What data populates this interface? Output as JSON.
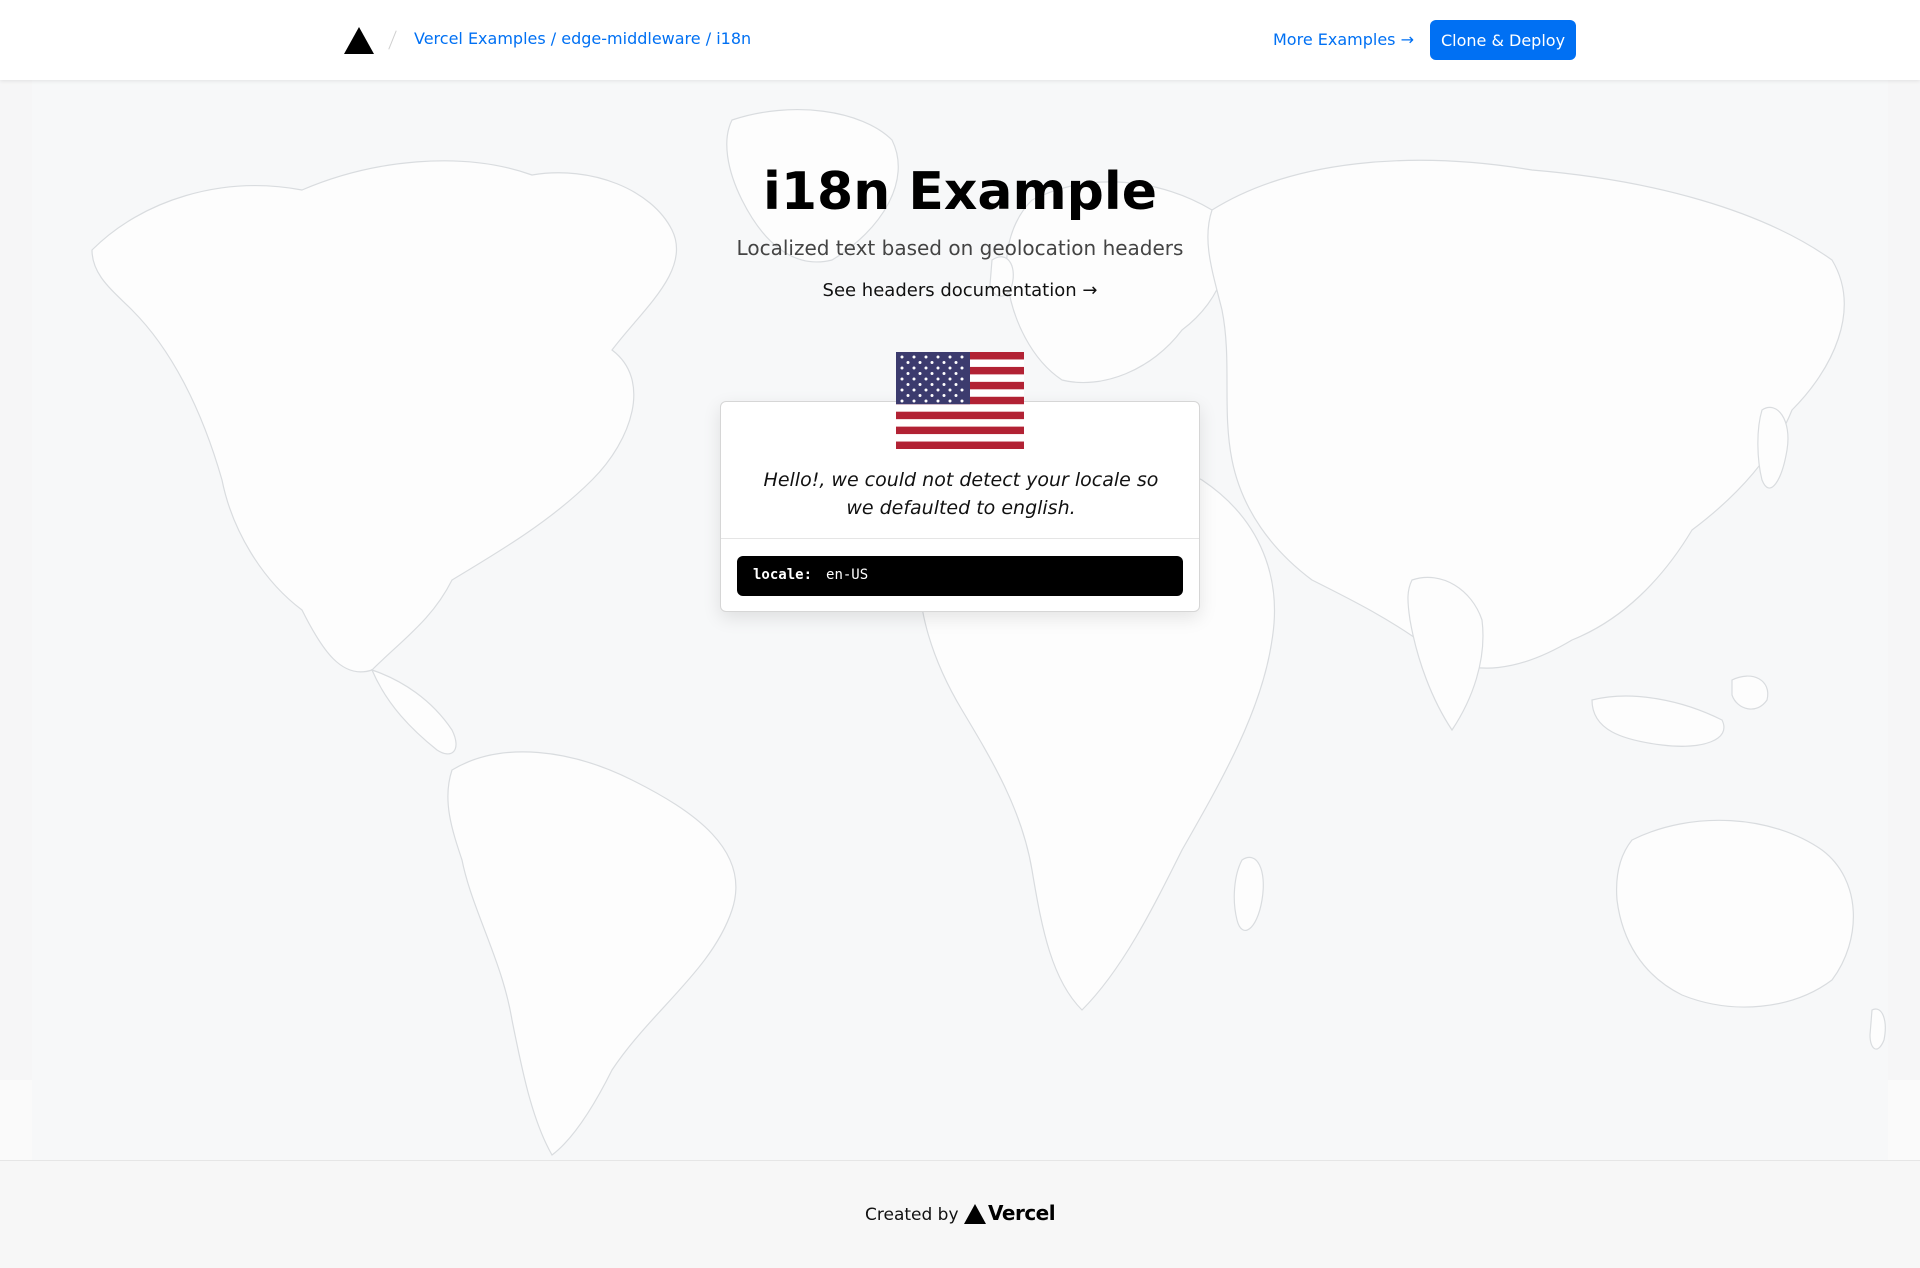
{
  "header": {
    "breadcrumb": "Vercel Examples / edge-middleware / i18n",
    "more_examples": "More Examples →",
    "clone_deploy": "Clone & Deploy"
  },
  "hero": {
    "title": "i18n Example",
    "subtitle": "Localized text based on geolocation headers",
    "docs_link": "See headers documentation →"
  },
  "card": {
    "message": "Hello!, we could not detect your locale so we defaulted to english.",
    "code_key": "locale:",
    "code_value": "en-US"
  },
  "footer": {
    "created_by": "Created by",
    "brand": "Vercel"
  },
  "icons": {
    "logo": "vercel-triangle-icon",
    "flag": "us-flag-icon"
  },
  "colors": {
    "accent": "#0070f3",
    "flag_red": "#b22234",
    "flag_blue": "#3c3b6e"
  }
}
